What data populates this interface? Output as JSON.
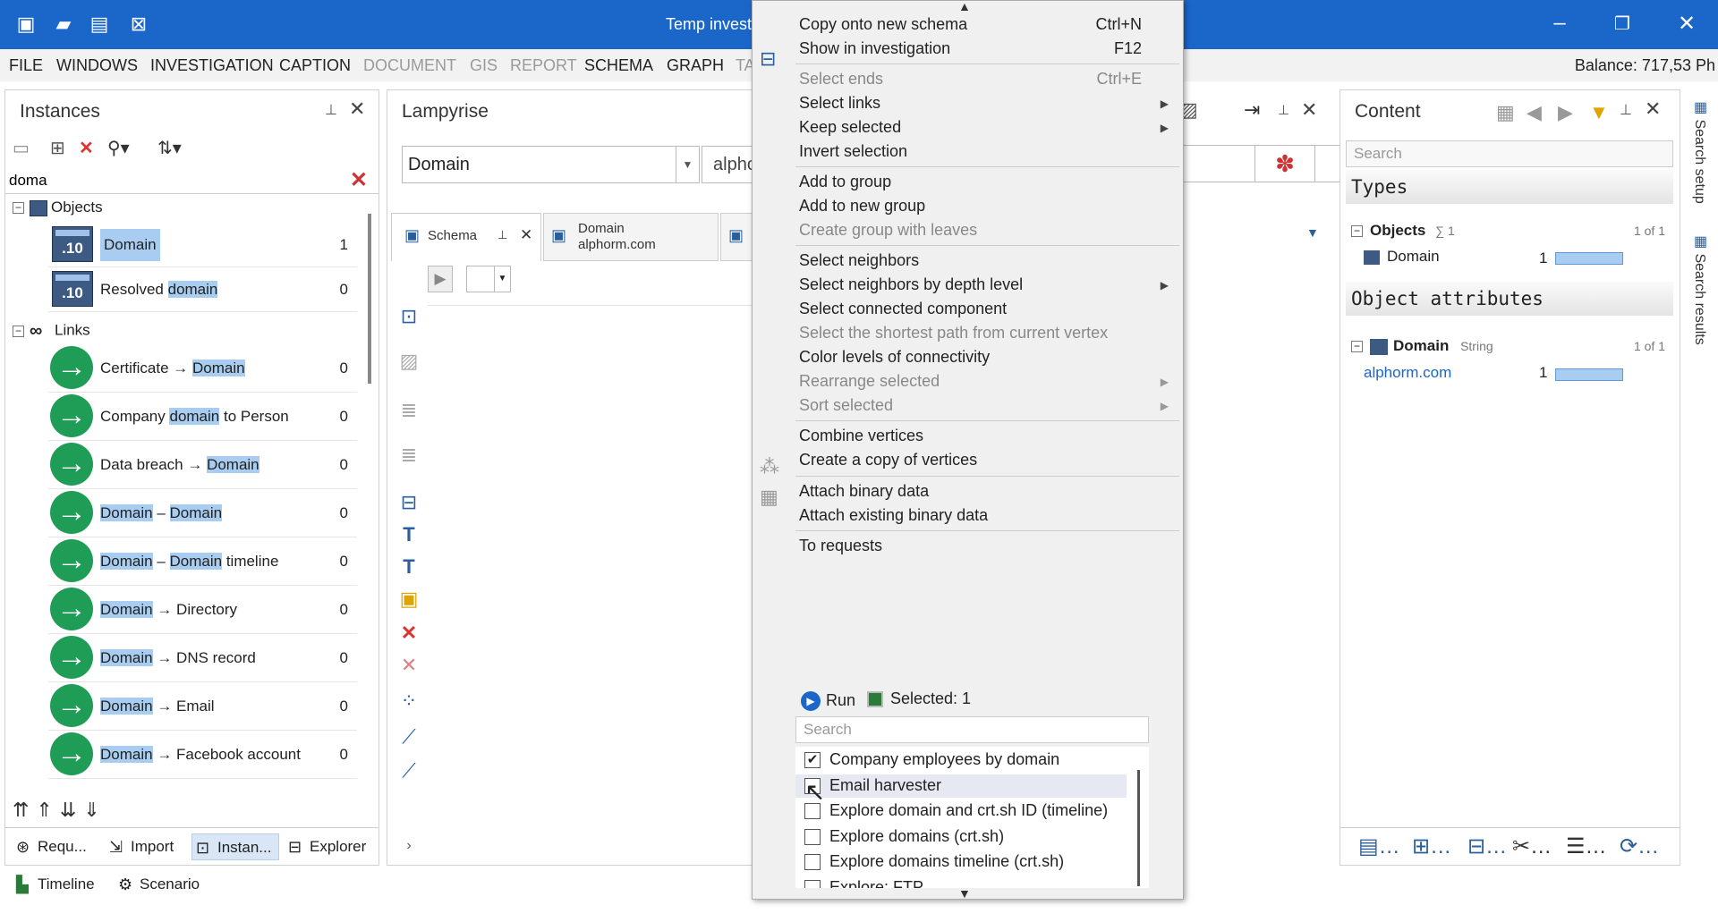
{
  "titlebar": {
    "title": "Temp investig",
    "bg": "#1a66c9"
  },
  "menubar": {
    "items": [
      "FILE",
      "WINDOWS",
      "INVESTIGATION",
      "CAPTION",
      "DOCUMENT",
      "GIS",
      "REPORT",
      "SCHEMA",
      "GRAPH",
      "TA"
    ],
    "balance": "Balance: 717,53 Ph"
  },
  "instances": {
    "title": "Instances",
    "search_value": "doma",
    "groups": {
      "objects": "Objects",
      "links": "Links"
    },
    "objects": [
      {
        "pre": "",
        "hl": "Domain",
        "post": "",
        "count": "1"
      },
      {
        "pre": "Resolved ",
        "hl": "domain",
        "post": "",
        "count": "0"
      }
    ],
    "links": [
      {
        "pre": "Certificate → ",
        "hl": "Domain",
        "post": "",
        "count": "0"
      },
      {
        "pre": "Company ",
        "hl": "domain",
        "post": " to Person",
        "count": "0"
      },
      {
        "pre": "Data breach → ",
        "hl": "Domain",
        "post": "",
        "count": "0"
      },
      {
        "pre": "",
        "hl": "Domain",
        "post": " – ",
        "hl2": "Domain",
        "post2": "",
        "count": "0"
      },
      {
        "pre": "",
        "hl": "Domain",
        "post": " – ",
        "hl2": "Domain",
        "post2": " timeline",
        "count": "0"
      },
      {
        "pre": "",
        "hl": "Domain",
        "post": " → Directory",
        "count": "0"
      },
      {
        "pre": "",
        "hl": "Domain",
        "post": " → DNS record",
        "count": "0"
      },
      {
        "pre": "",
        "hl": "Domain",
        "post": " → Email",
        "count": "0"
      },
      {
        "pre": "",
        "hl": "Domain",
        "post": " → Facebook account",
        "count": "0"
      }
    ],
    "tabs": [
      "Requ...",
      "Import",
      "Instan...",
      "Explorer"
    ]
  },
  "bottombar": {
    "timeline": "Timeline",
    "scenario": "Scenario"
  },
  "lampyrise": {
    "title": "Lampyrise",
    "combo_value": "Domain",
    "combo2_value": "alpho",
    "tabs": [
      {
        "label": "Schema"
      },
      {
        "label": "Domain",
        "sub": "alphorm.com"
      }
    ]
  },
  "content": {
    "title": "Content",
    "search_placeholder": "Search",
    "types_header": "Types",
    "objects_label": "Objects",
    "objects_sum": "∑ 1",
    "objects_page": "1 of 1",
    "type_row": {
      "label": "Domain",
      "count": "1"
    },
    "attr_header": "Object attributes",
    "attr_group": {
      "label": "Domain",
      "type": "String",
      "page": "1 of 1"
    },
    "attr_row": {
      "label": "alphorm.com",
      "count": "1"
    }
  },
  "vtabs": [
    "Search setup",
    "Search results"
  ],
  "context_menu": {
    "items": [
      {
        "label": "Copy onto new schema",
        "shortcut": "Ctrl+N"
      },
      {
        "label": "Show in investigation",
        "shortcut": "F12"
      },
      {
        "label": "Select ends",
        "shortcut": "Ctrl+E",
        "disabled": true
      },
      {
        "label": "Select links"
      },
      {
        "label": "Keep selected"
      },
      {
        "label": "Invert selection"
      },
      {
        "label": "Add to group"
      },
      {
        "label": "Add to new group"
      },
      {
        "label": "Create group with leaves",
        "disabled": true
      },
      {
        "label": "Select neighbors"
      },
      {
        "label": "Select neighbors by depth level"
      },
      {
        "label": "Select connected component"
      },
      {
        "label": "Select the shortest path from current vertex",
        "disabled": true
      },
      {
        "label": "Color levels of connectivity"
      },
      {
        "label": "Rearrange selected",
        "disabled": true
      },
      {
        "label": "Sort selected",
        "disabled": true
      },
      {
        "label": "Combine vertices"
      },
      {
        "label": "Create a copy of vertices"
      },
      {
        "label": "Attach binary data"
      },
      {
        "label": "Attach existing binary data"
      },
      {
        "label": "To requests"
      }
    ],
    "run_label": "Run",
    "selected_label": "Selected: 1",
    "search_placeholder": "Search",
    "requests": [
      {
        "label": "Company employees by domain",
        "checked": true
      },
      {
        "label": "Email harvester",
        "checked": false
      },
      {
        "label": "Explore domain and crt.sh ID (timeline)",
        "checked": false
      },
      {
        "label": "Explore domains (crt.sh)",
        "checked": false
      },
      {
        "label": "Explore domains timeline (crt.sh)",
        "checked": false
      },
      {
        "label": "Explore: FTP",
        "checked": false
      }
    ]
  },
  "colors": {
    "accent": "#1a66c9",
    "highlight": "#a8cdf0",
    "link_green": "#1f9d56"
  }
}
